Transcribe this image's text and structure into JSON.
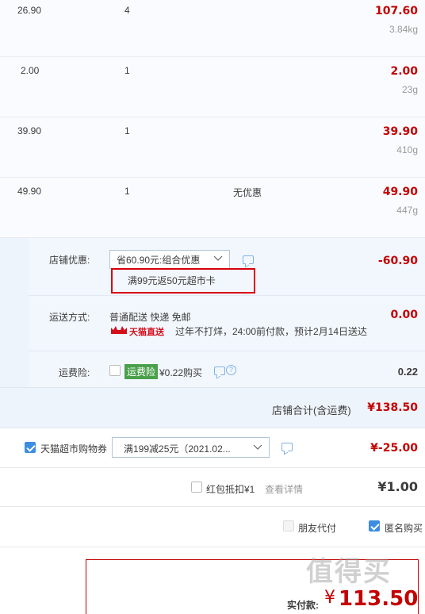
{
  "items": [
    {
      "price": "26.90",
      "qty": "4",
      "promo": "",
      "total": "107.60",
      "weight": "3.84kg"
    },
    {
      "price": "2.00",
      "qty": "1",
      "promo": "",
      "total": "2.00",
      "weight": "23g"
    },
    {
      "price": "39.90",
      "qty": "1",
      "promo": "",
      "total": "39.90",
      "weight": "410g"
    },
    {
      "price": "49.90",
      "qty": "1",
      "promo": "无优惠",
      "total": "49.90",
      "weight": "447g"
    }
  ],
  "shop": {
    "discount_label": "店铺优惠:",
    "discount_select": "省60.90元:组合优惠",
    "discount_amount": "-60.90",
    "discount_detail": "满99元返50元超市卡",
    "shipping_label": "运送方式:",
    "shipping_method": "普通配送 快递 免邮",
    "shipping_amount": "0.00",
    "tmall_badge": "天猫直送",
    "shipping_note": "过年不打烊，24:00前付款，预计2月14日送达",
    "insurance_label": "运费险:",
    "insurance_badge": "运费险",
    "insurance_price": "¥0.22购买",
    "insurance_amount": "0.22",
    "subtotal_label": "店铺合计(含运费)",
    "subtotal_amount": "¥138.50"
  },
  "coupon": {
    "label": "天猫超市购物券",
    "select": "满199减25元（2021.02...",
    "amount": "¥-25.00"
  },
  "redpacket": {
    "label": "红包抵扣¥1",
    "link": "查看详情",
    "amount": "¥1.00"
  },
  "options": {
    "friend_pay": "朋友代付",
    "anonymous": "匿名购买"
  },
  "payment": {
    "label": "实付款:",
    "currency": "¥",
    "amount": "113.50"
  },
  "watermark": "值得买",
  "colors": {
    "accent_red": "#c40000",
    "tmall_green": "#4aa04a",
    "link_blue": "#3d8de2",
    "highlight_box": "#d9000b"
  }
}
